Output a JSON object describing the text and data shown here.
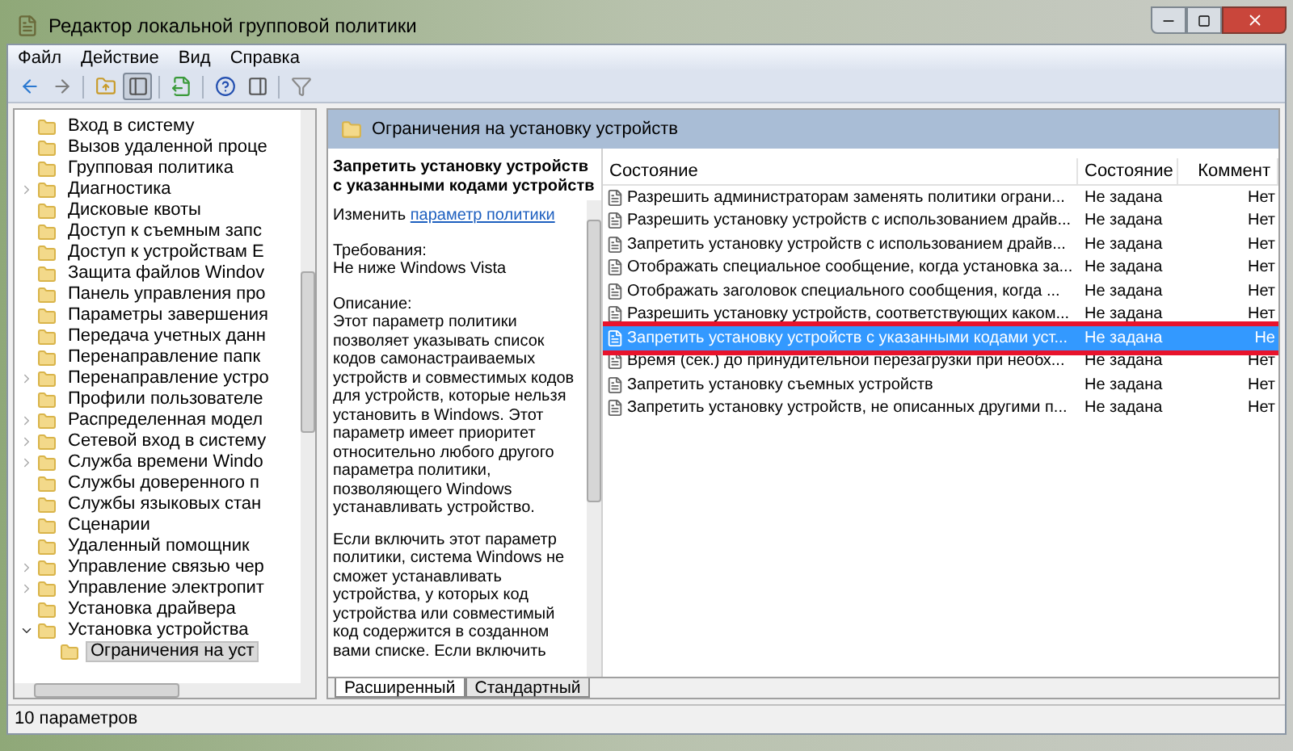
{
  "window": {
    "title": "Редактор локальной групповой политики"
  },
  "menu": [
    "Файл",
    "Действие",
    "Вид",
    "Справка"
  ],
  "toolbar": [
    {
      "kind": "back",
      "pressed": false
    },
    {
      "kind": "forward",
      "pressed": false
    },
    {
      "kind": "up",
      "pressed": false
    },
    {
      "kind": "tree",
      "pressed": true
    },
    {
      "kind": "export",
      "pressed": false
    },
    {
      "kind": "help",
      "pressed": false
    },
    {
      "kind": "pane",
      "pressed": false
    },
    {
      "kind": "filter",
      "pressed": false
    }
  ],
  "tree": [
    {
      "label": "Вход в систему",
      "selected": false
    },
    {
      "label": "Вызов удаленной проце",
      "selected": false
    },
    {
      "label": "Групповая политика",
      "selected": false
    },
    {
      "label": "Диагностика",
      "expanded": false,
      "selected": false
    },
    {
      "label": "Дисковые квоты",
      "selected": false
    },
    {
      "label": "Доступ к съемным запс",
      "selected": false
    },
    {
      "label": "Доступ к устройствам E",
      "selected": false
    },
    {
      "label": "Защита файлов Windov",
      "selected": false
    },
    {
      "label": "Панель управления про",
      "selected": false
    },
    {
      "label": "Параметры завершения",
      "selected": false
    },
    {
      "label": "Передача учетных данн",
      "selected": false
    },
    {
      "label": "Перенаправление папк",
      "selected": false
    },
    {
      "label": "Перенаправление устро",
      "expanded": false,
      "selected": false
    },
    {
      "label": "Профили пользователе",
      "selected": false
    },
    {
      "label": "Распределенная модел",
      "expanded": false,
      "selected": false
    },
    {
      "label": "Сетевой вход в систему",
      "expanded": false,
      "selected": false
    },
    {
      "label": "Служба времени Windo",
      "expanded": false,
      "selected": false
    },
    {
      "label": "Службы доверенного п",
      "selected": false
    },
    {
      "label": "Службы языковых стан",
      "selected": false
    },
    {
      "label": "Сценарии",
      "selected": false
    },
    {
      "label": "Удаленный помощник",
      "selected": false
    },
    {
      "label": "Управление связью чер",
      "expanded": false,
      "selected": false
    },
    {
      "label": "Управление электропит",
      "expanded": false,
      "selected": false
    },
    {
      "label": "Установка драйвера",
      "selected": false
    },
    {
      "label": "Установка устройства",
      "expanded": true,
      "selected": false,
      "children": [
        {
          "label": "Ограничения на уст",
          "selected": true
        }
      ]
    }
  ],
  "pane_header": "Ограничения на установку устройств",
  "description": {
    "title": "Запретить установку устройств с указанными кодами устройств",
    "edit_prefix": "Изменить",
    "edit_link": "параметр политики",
    "requirements_label": "Требования:",
    "requirements": "Не ниже Windows Vista",
    "description_label": "Описание:",
    "paragraphs": [
      "Этот параметр политики позволяет указывать список кодов самонастраиваемых устройств и совместимых кодов для устройств, которые нельзя установить в Windows. Этот параметр имеет приоритет относительно любого другого параметра политики, позволяющего Windows устанавливать устройство.",
      "Если включить этот параметр политики, система Windows не сможет устанавливать устройства, у которых код устройства или совместимый код содержится в созданном вами списке. Если включить"
    ]
  },
  "table": {
    "columns": [
      "Состояние",
      "Состояние",
      "Коммент"
    ],
    "rows": [
      {
        "name": "Разрешить администраторам заменять политики ограни...",
        "state": "Не задана",
        "comment": "Нет",
        "selected": false,
        "outlined": false
      },
      {
        "name": "Разрешить установку устройств с использованием драйв...",
        "state": "Не задана",
        "comment": "Нет",
        "selected": false,
        "outlined": false
      },
      {
        "name": "Запретить установку устройств с использованием драйв...",
        "state": "Не задана",
        "comment": "Нет",
        "selected": false,
        "outlined": false
      },
      {
        "name": "Отображать специальное сообщение, когда установка за...",
        "state": "Не задана",
        "comment": "Нет",
        "selected": false,
        "outlined": false
      },
      {
        "name": "Отображать заголовок специального сообщения, когда ...",
        "state": "Не задана",
        "comment": "Нет",
        "selected": false,
        "outlined": false
      },
      {
        "name": "Разрешить установку устройств, соответствующих каком...",
        "state": "Не задана",
        "comment": "Нет",
        "selected": false,
        "outlined": false
      },
      {
        "name": "Запретить установку устройств с указанными кодами уст...",
        "state": "Не задана",
        "comment": "Не",
        "selected": true,
        "outlined": true
      },
      {
        "name": "Время (сек.) до принудительной перезагрузки при необх...",
        "state": "Не задана",
        "comment": "Нет",
        "selected": false,
        "outlined": false
      },
      {
        "name": "Запретить установку съемных устройств",
        "state": "Не задана",
        "comment": "Нет",
        "selected": false,
        "outlined": false
      },
      {
        "name": "Запретить установку устройств, не описанных другими п...",
        "state": "Не задана",
        "comment": "Нет",
        "selected": false,
        "outlined": false
      }
    ]
  },
  "tabs": [
    {
      "label": "Расширенный",
      "selected": true
    },
    {
      "label": "Стандартный",
      "selected": false
    }
  ],
  "status_bar": "10 параметров"
}
